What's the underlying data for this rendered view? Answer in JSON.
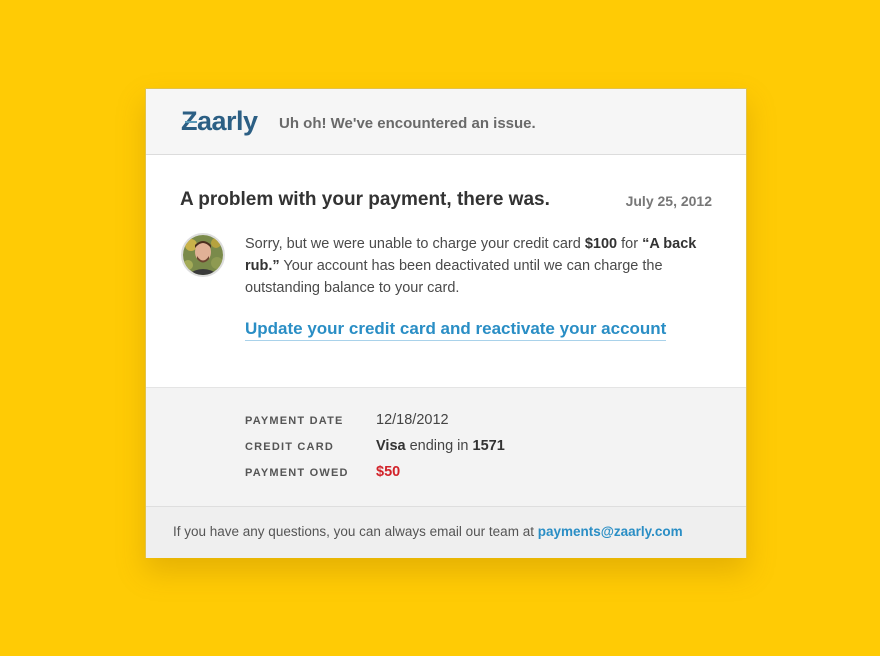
{
  "header": {
    "logo_text": "Zaarly",
    "tagline": "Uh oh! We've encountered an issue."
  },
  "main": {
    "headline": "A problem with your payment, there was.",
    "date": "July 25, 2012",
    "message": {
      "part1": "Sorry, but we were unable to charge your credit card ",
      "amount": "$100",
      "part2": " for ",
      "item": "“A back rub.”",
      "part3": " Your account has been deactivated until we can charge the outstanding balance to your card."
    },
    "cta_label": "Update your credit card and reactivate your account"
  },
  "details": {
    "payment_date": {
      "label": "PAYMENT DATE",
      "value": "12/18/2012"
    },
    "credit_card": {
      "label": "CREDIT CARD",
      "brand": "Visa",
      "middle": " ending in ",
      "last4": "1571"
    },
    "payment_owed": {
      "label": "PAYMENT OWED",
      "value": "$50"
    }
  },
  "footer": {
    "text": "If you have any questions, you can always email our team at ",
    "email": "payments@zaarly.com"
  },
  "colors": {
    "background": "#ffcb05",
    "link": "#2a8ec5",
    "owed": "#d2232a",
    "brand": "#2c5f84"
  }
}
